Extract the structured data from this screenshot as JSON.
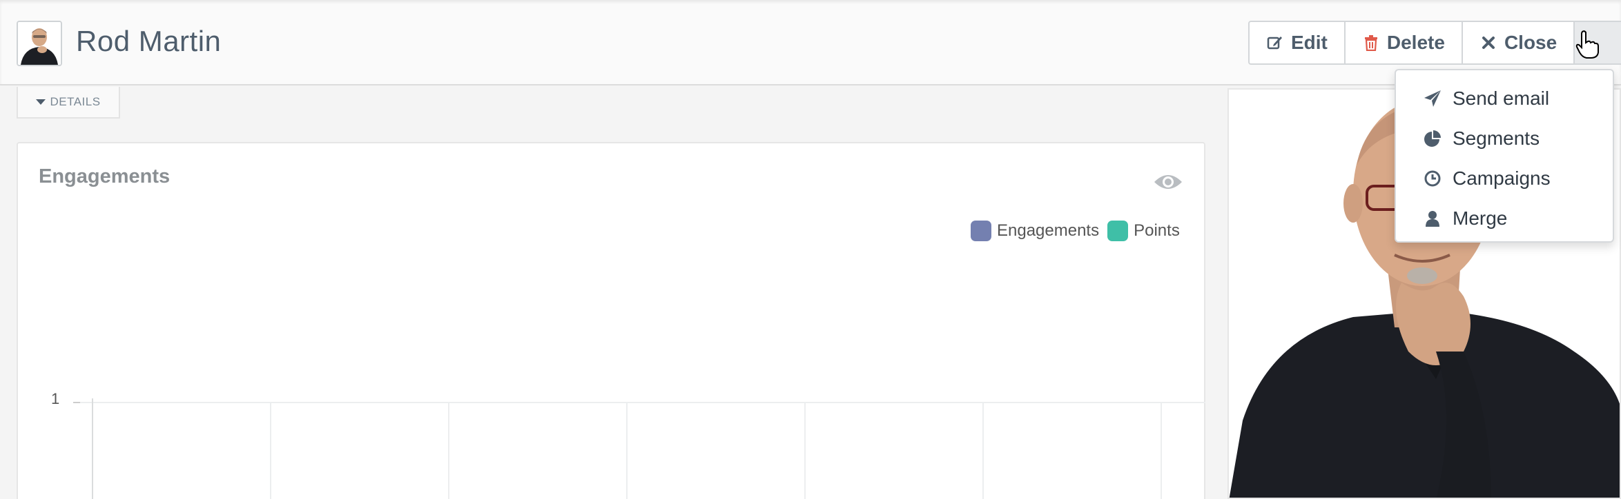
{
  "header": {
    "contact_name": "Rod Martin",
    "buttons": {
      "edit": "Edit",
      "delete": "Delete",
      "close": "Close"
    }
  },
  "details_tab": {
    "label": "DETAILS"
  },
  "engagements": {
    "title": "Engagements",
    "legend": [
      {
        "label": "Engagements",
        "color": "#7480b0"
      },
      {
        "label": "Points",
        "color": "#3fbfa7"
      }
    ],
    "y_tick": "1"
  },
  "dropdown": {
    "items": [
      {
        "label": "Send email",
        "icon": "paper-plane-icon"
      },
      {
        "label": "Segments",
        "icon": "pie-chart-icon"
      },
      {
        "label": "Campaigns",
        "icon": "clock-icon"
      },
      {
        "label": "Merge",
        "icon": "user-icon"
      }
    ]
  },
  "colors": {
    "delete_icon": "#e05a4a",
    "text": "#4e5d6c",
    "grid": "#eceeef"
  }
}
